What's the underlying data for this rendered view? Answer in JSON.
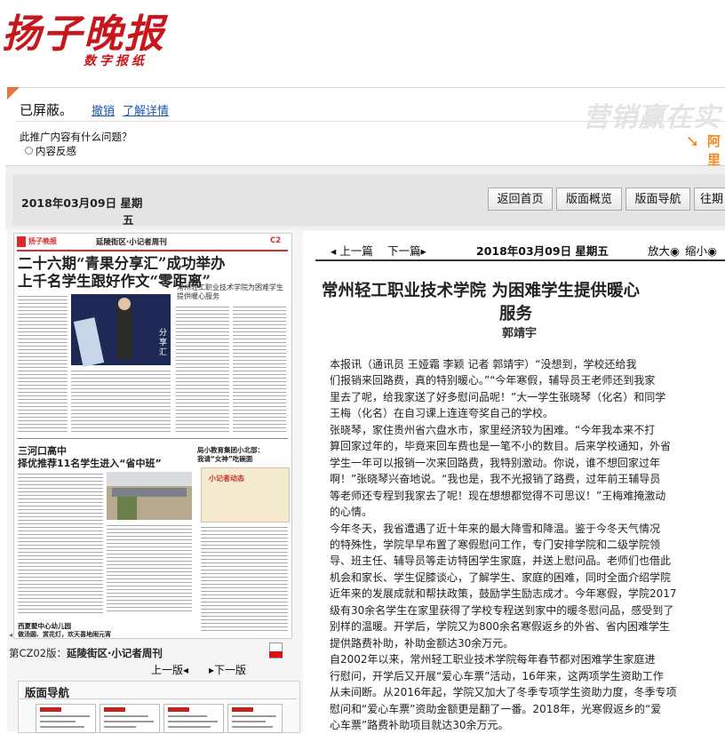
{
  "masthead": {
    "logo": "扬子晚报",
    "logo_sub": "数字报纸",
    "brand_color": "#c8161d"
  },
  "ad": {
    "blocked_text": "已屏蔽。",
    "undo_label": "撤销",
    "details_label": "了解详情",
    "question": "此推广内容有什么问题？",
    "feedback_option": "内容反感",
    "slogan": "营销赢在实",
    "brand_icon": "arrow-logo-icon",
    "brand": "阿里"
  },
  "nav": {
    "date_part1": "2018年03月09日  星期",
    "date_part2": "五",
    "buttons": [
      "返回首页",
      "版面概览",
      "版面导航",
      "往期"
    ]
  },
  "newspaper": {
    "paper_name": "扬子晚报",
    "section": "延陵街区·小记者周刊",
    "page_code": "C2",
    "headline1_line1": "二十六期“青果分享汇”成功举办",
    "headline1_line2": "上千名学生跟好作文“零距离”",
    "sub1": "常州轻工职业技术学院为困难学生提供暖心服务",
    "photo_text": "分享汇",
    "headline2_line1": "三河口高中",
    "headline2_line2": "择优推荐11名学生进入“省中班”",
    "headline3_line1": "局小教育集团小北部：",
    "headline3_line2": "我请“女神”吃碗面",
    "ad_title": "小记者动态",
    "headline4_line1": "西夏墅中心幼儿园",
    "headline4_line2": "做汤圆、赏花灯，欢天喜地闹元宵"
  },
  "page_nav": {
    "page_label_prefix": "第CZ02版：",
    "page_label_name": "延陵街区·小记者周刊",
    "prev_label": "上一版◂",
    "next_label": "▸下一版",
    "thumb_title": "版面导航"
  },
  "article": {
    "prev_label": "◂ 上一篇",
    "next_label": "下一篇▸",
    "date": "2018年03月09日  星期五",
    "zoom_in": "放大◉",
    "zoom_out": "缩小◉",
    "title_line1": "常州轻工职业技术学院  为困难学生提供暖心",
    "title_line2": "服务",
    "author": "郭靖宇",
    "lines": [
      "    本报讯（通讯员 王娅霜 李颖 记者  郭靖宇）“没想到，学校还给我",
      "们报销来回路费，真的特别暖心。”“今年寒假，辅导员王老师还到我家",
      "里去了呢，给我家送了好多慰问品呢！”大一学生张晓琴（化名）和同学",
      "王梅（化名）在自习课上连连夸奖自己的学校。",
      "    张晓琴，家住贵州省六盘水市，家里经济较为困难。“今年我本来不打",
      "算回家过年的，毕竟来回车费也是一笔不小的数目。后来学校通知，外省",
      "学生一年可以报销一次来回路费，我特别激动。你说，谁不想回家过年",
      "啊！”张晓琴兴奋地说。“我也是，我不光报销了路费，过年前王辅导员",
      "等老师还专程到我家去了呢！现在想想都觉得不可思议！”王梅难掩激动",
      "的心情。",
      "    今年冬天，我省遭遇了近十年来的最大降雪和降温。鉴于今冬天气情况",
      "的特殊性，学院早早布置了寒假慰问工作，专门安排学院和二级学院领",
      "导、班主任、辅导员等走访特困学生家庭，并送上慰问品。老师们也借此",
      "机会和家长、学生促膝谈心，了解学生、家庭的困难，同时全面介绍学院",
      "近年来的发展成就和帮扶政策，鼓励学生励志成才。今年寒假，学院2017",
      "级有30余名学生在家里获得了学校专程送到家中的暖冬慰问品，感受到了",
      "别样的温暖。开学后，学院又为800余名寒假返乡的外省、省内困难学生",
      "提供路费补助，补助金额达30余万元。",
      "    自2002年以来，常州轻工职业技术学院每年春节都对困难学生家庭进",
      "行慰问，开学后又开展“爱心车票”活动，16年来，这两项学生资助工作",
      "从未间断。从2016年起，学院又加大了冬季专项学生资助力度，冬季专项",
      "慰问和“爱心车票”资助金额更是翻了一番。2018年，光寒假返乡的“爱",
      "心车票”路费补助项目就达30余万元。"
    ]
  }
}
